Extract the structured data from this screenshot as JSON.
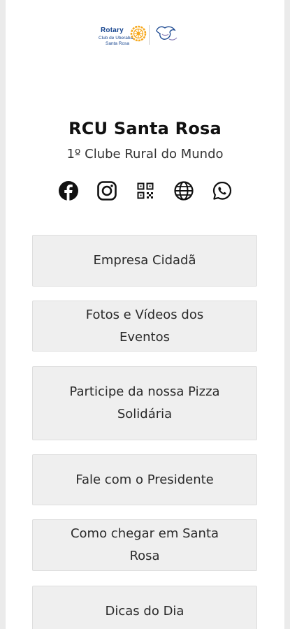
{
  "logo": {
    "brand": "Rotary",
    "line1": "Club de Uberaba",
    "line2": "Santa Rosa",
    "colors": {
      "blue": "#17458f",
      "gold": "#f7a81b"
    }
  },
  "profile": {
    "title": "RCU Santa Rosa",
    "subtitle": "1º Clube Rural do Mundo"
  },
  "socials": [
    {
      "name": "facebook-icon"
    },
    {
      "name": "instagram-icon"
    },
    {
      "name": "qr-code-icon"
    },
    {
      "name": "globe-icon"
    },
    {
      "name": "whatsapp-icon"
    }
  ],
  "links": [
    {
      "label": "Empresa Cidadã"
    },
    {
      "label": "Fotos e Vídeos dos Eventos"
    },
    {
      "label": "Participe da nossa Pizza Solidária"
    },
    {
      "label": "Fale com o Presidente"
    },
    {
      "label": "Como chegar em Santa Rosa"
    },
    {
      "label": "Dicas do Dia"
    }
  ]
}
